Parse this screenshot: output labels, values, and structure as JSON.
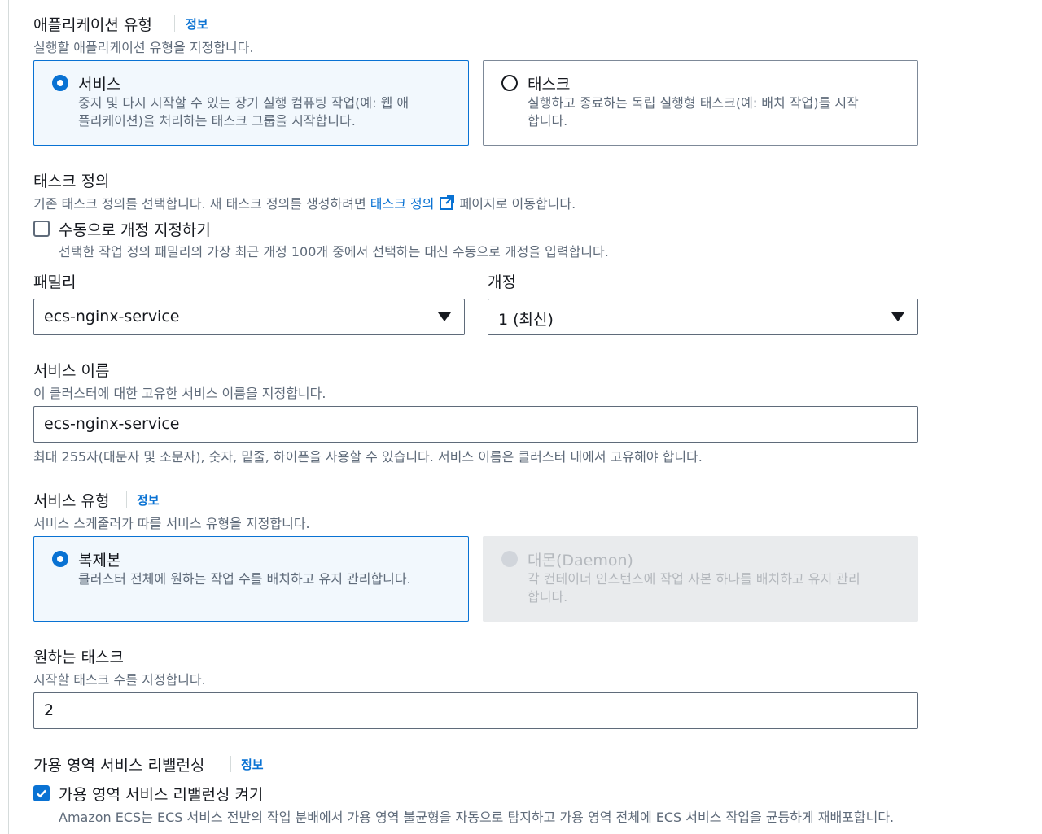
{
  "app_type": {
    "label": "애플리케이션 유형",
    "info": "정보",
    "description": "실행할 애플리케이션 유형을 지정합니다.",
    "options": [
      {
        "title": "서비스",
        "description_line1": "중지 및 다시 시작할 수 있는 장기 실행 컴퓨팅 작업(예: 웹 애",
        "description_line2": "플리케이션)을 처리하는 태스크 그룹을 시작합니다.",
        "selected": true
      },
      {
        "title": "태스크",
        "description_line1": "실행하고 종료하는 독립 실행형 태스크(예: 배치 작업)를 시작",
        "description_line2": "합니다.",
        "selected": false
      }
    ]
  },
  "task_definition": {
    "label": "태스크 정의",
    "description_prefix": "기존 태스크 정의를 선택합니다. 새 태스크 정의를 생성하려면 ",
    "link_text": "태스크 정의",
    "description_suffix": " 페이지로 이동합니다.",
    "manual_revision": {
      "label": "수동으로 개정 지정하기",
      "description": "선택한 작업 정의 패밀리의 가장 최근 개정 100개 중에서 선택하는 대신 수동으로 개정을 입력합니다.",
      "checked": false
    },
    "family": {
      "label": "패밀리",
      "value": "ecs-nginx-service"
    },
    "revision": {
      "label": "개정",
      "value": "1 (최신)"
    }
  },
  "service_name": {
    "label": "서비스 이름",
    "description": "이 클러스터에 대한 고유한 서비스 이름을 지정합니다.",
    "value": "ecs-nginx-service",
    "constraint": "최대 255자(대문자 및 소문자), 숫자, 밑줄, 하이픈을 사용할 수 있습니다. 서비스 이름은 클러스터 내에서 고유해야 합니다."
  },
  "service_type": {
    "label": "서비스 유형",
    "info": "정보",
    "description": "서비스 스케줄러가 따를 서비스 유형을 지정합니다.",
    "options": [
      {
        "title": "복제본",
        "description_line1": "클러스터 전체에 원하는 작업 수를 배치하고 유지 관리합니다.",
        "description_line2": "",
        "selected": true,
        "disabled": false
      },
      {
        "title": "대몬(Daemon)",
        "description_line1": "각 컨테이너 인스턴스에 작업 사본 하나를 배치하고 유지 관리",
        "description_line2": "합니다.",
        "selected": false,
        "disabled": true
      }
    ]
  },
  "desired_tasks": {
    "label": "원하는 태스크",
    "description": "시작할 태스크 수를 지정합니다.",
    "value": "2"
  },
  "az_rebalancing": {
    "label": "가용 영역 서비스 리밸런싱",
    "info": "정보",
    "checkbox_label": "가용 영역 서비스 리밸런싱 켜기",
    "description": "Amazon ECS는 ECS 서비스 전반의 작업 분배에서 가용 영역 불균형을 자동으로 탐지하고 가용 영역 전체에 ECS 서비스 작업을 균등하게 재배포합니다.",
    "checked": true
  },
  "colors": {
    "accent": "#0972d3",
    "text": "#16191f",
    "secondary_text": "#5f6b7a",
    "disabled_tile": "#e9ebed"
  }
}
